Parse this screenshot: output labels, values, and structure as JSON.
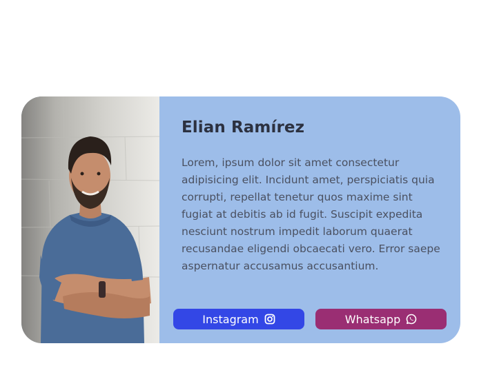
{
  "profile": {
    "name": "Elian Ramírez",
    "bio": "Lorem, ipsum dolor sit amet consectetur adipisicing elit. Incidunt amet, perspiciatis quia corrupti, repellat tenetur quos maxime sint fugiat at debitis ab id fugit. Suscipit expedita nesciunt nostrum impedit laborum quaerat recusandae eligendi obcaecati vero. Error saepe aspernatur accusamus accusantium."
  },
  "buttons": {
    "instagram": {
      "label": "Instagram",
      "icon": "instagram-icon"
    },
    "whatsapp": {
      "label": "Whatsapp",
      "icon": "whatsapp-icon"
    }
  },
  "colors": {
    "card_background": "#9dbde9",
    "instagram_button": "#3347e6",
    "whatsapp_button": "#9a2e73",
    "name_text": "#2c3140",
    "bio_text": "#4a5060"
  }
}
